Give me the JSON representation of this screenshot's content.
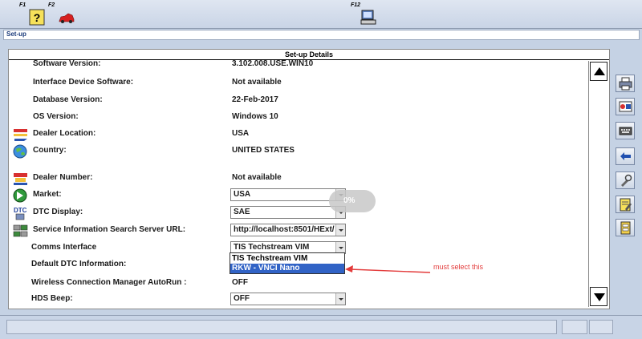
{
  "toolbar": {
    "f1_label": "F1",
    "f1_icon": "help-question-icon",
    "f2_label": "F2",
    "f2_icon": "vehicle-car-icon",
    "f12_label": "F12",
    "f12_icon": "pc-monitor-icon"
  },
  "section": {
    "title": "Set-up"
  },
  "panel": {
    "header": "Set-up Details",
    "rows": [
      {
        "label": "Software Version:",
        "value": "3.102.008.USE.WIN10"
      },
      {
        "label": "Interface Device Software:",
        "value": "Not available"
      },
      {
        "label": "Database Version:",
        "value": "22-Feb-2017"
      },
      {
        "label": "OS Version:",
        "value": "Windows 10"
      },
      {
        "label": "Dealer Location:",
        "value": "USA",
        "icon": "dealer-location-icon"
      },
      {
        "label": "Country:",
        "value": "UNITED STATES",
        "icon": "globe-icon"
      },
      {
        "label": "Dealer Number:",
        "value": "Not available",
        "icon": "dealer-number-icon"
      },
      {
        "label": "Market:",
        "value": "USA",
        "icon": "market-icon"
      },
      {
        "label": "DTC Display:",
        "value": "SAE",
        "icon": "dtc-icon"
      },
      {
        "label": "Service Information Search Server URL:",
        "value": "http://localhost:8501/HExt/",
        "icon": "server-icon"
      },
      {
        "label": "Comms Interface",
        "value": "TIS Techstream VIM"
      },
      {
        "label": "Default DTC Information:",
        "value": ""
      },
      {
        "label": "Wireless Connection Manager AutoRun :",
        "value": "OFF"
      },
      {
        "label": "HDS Beep:",
        "value": "OFF"
      }
    ],
    "comms_options": [
      "TIS Techstream VIM",
      "RKW - VNCI Nano"
    ],
    "comms_selected_option": "RKW - VNCI Nano"
  },
  "overlay": {
    "progress_text": "0%"
  },
  "annotation": {
    "text": "must select this",
    "color": "#e33b3b"
  },
  "side_buttons": [
    "printer-icon",
    "print-screen-icon",
    "keyboard-icon",
    "back-arrow-icon",
    "tools-icon",
    "notes-edit-icon",
    "document-icon"
  ],
  "colors": {
    "selection": "#3163c6",
    "background": "#c5d2e4"
  }
}
